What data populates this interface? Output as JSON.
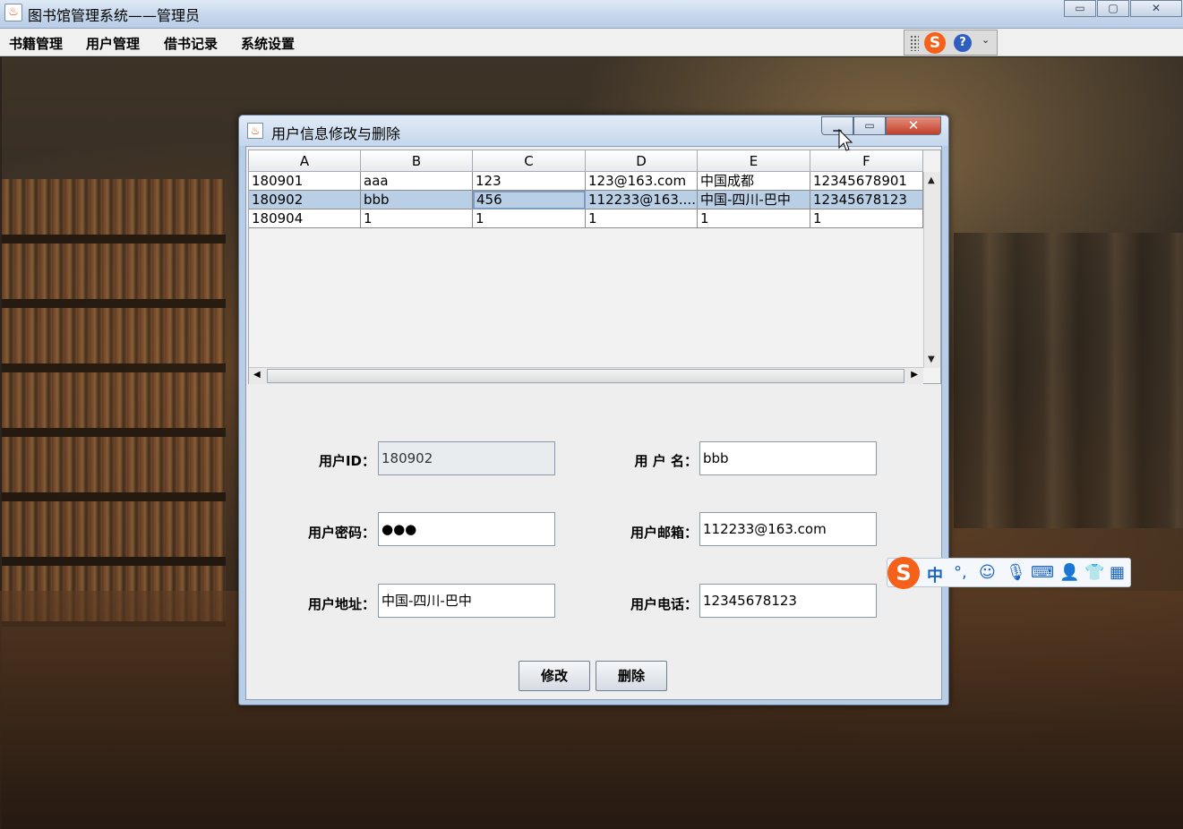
{
  "window": {
    "title": "图书馆管理系统——管理员",
    "icon": "java-cup-icon",
    "controls": {
      "minimize": "▭",
      "maximize": "▢",
      "close": "✕"
    }
  },
  "menubar": {
    "items": [
      "书籍管理",
      "用户管理",
      "借书记录",
      "系统设置"
    ]
  },
  "ime_toolbar": {
    "logo": "S",
    "help": "?",
    "menu": "⌄"
  },
  "dialog": {
    "title": "用户信息修改与删除",
    "controls": {
      "minimize": "▁",
      "maximize": "▭",
      "close": "✕"
    },
    "table": {
      "columns": [
        "A",
        "B",
        "C",
        "D",
        "E",
        "F"
      ],
      "rows": [
        [
          "180901",
          "aaa",
          "123",
          "123@163.com",
          "中国成都",
          "12345678901"
        ],
        [
          "180902",
          "bbb",
          "456",
          "112233@163....",
          "中国-四川-巴中",
          "12345678123"
        ],
        [
          "180904",
          "1",
          "1",
          "1",
          "1",
          "1"
        ]
      ],
      "selected_row": 1
    },
    "form": {
      "user_id_label": "用户ID：",
      "user_id_value": "180902",
      "username_label": "用 户 名：",
      "username_value": "bbb",
      "password_label": "用户密码：",
      "password_value": "●●●",
      "email_label": "用户邮箱：",
      "email_value": "112233@163.com",
      "address_label": "用户地址：",
      "address_value": "中国-四川-巴中",
      "phone_label": "用户电话：",
      "phone_value": "12345678123"
    },
    "buttons": {
      "modify": "修改",
      "delete": "删除"
    }
  },
  "ime_float": {
    "logo": "S",
    "mode": "中",
    "punct": "°,"
  }
}
